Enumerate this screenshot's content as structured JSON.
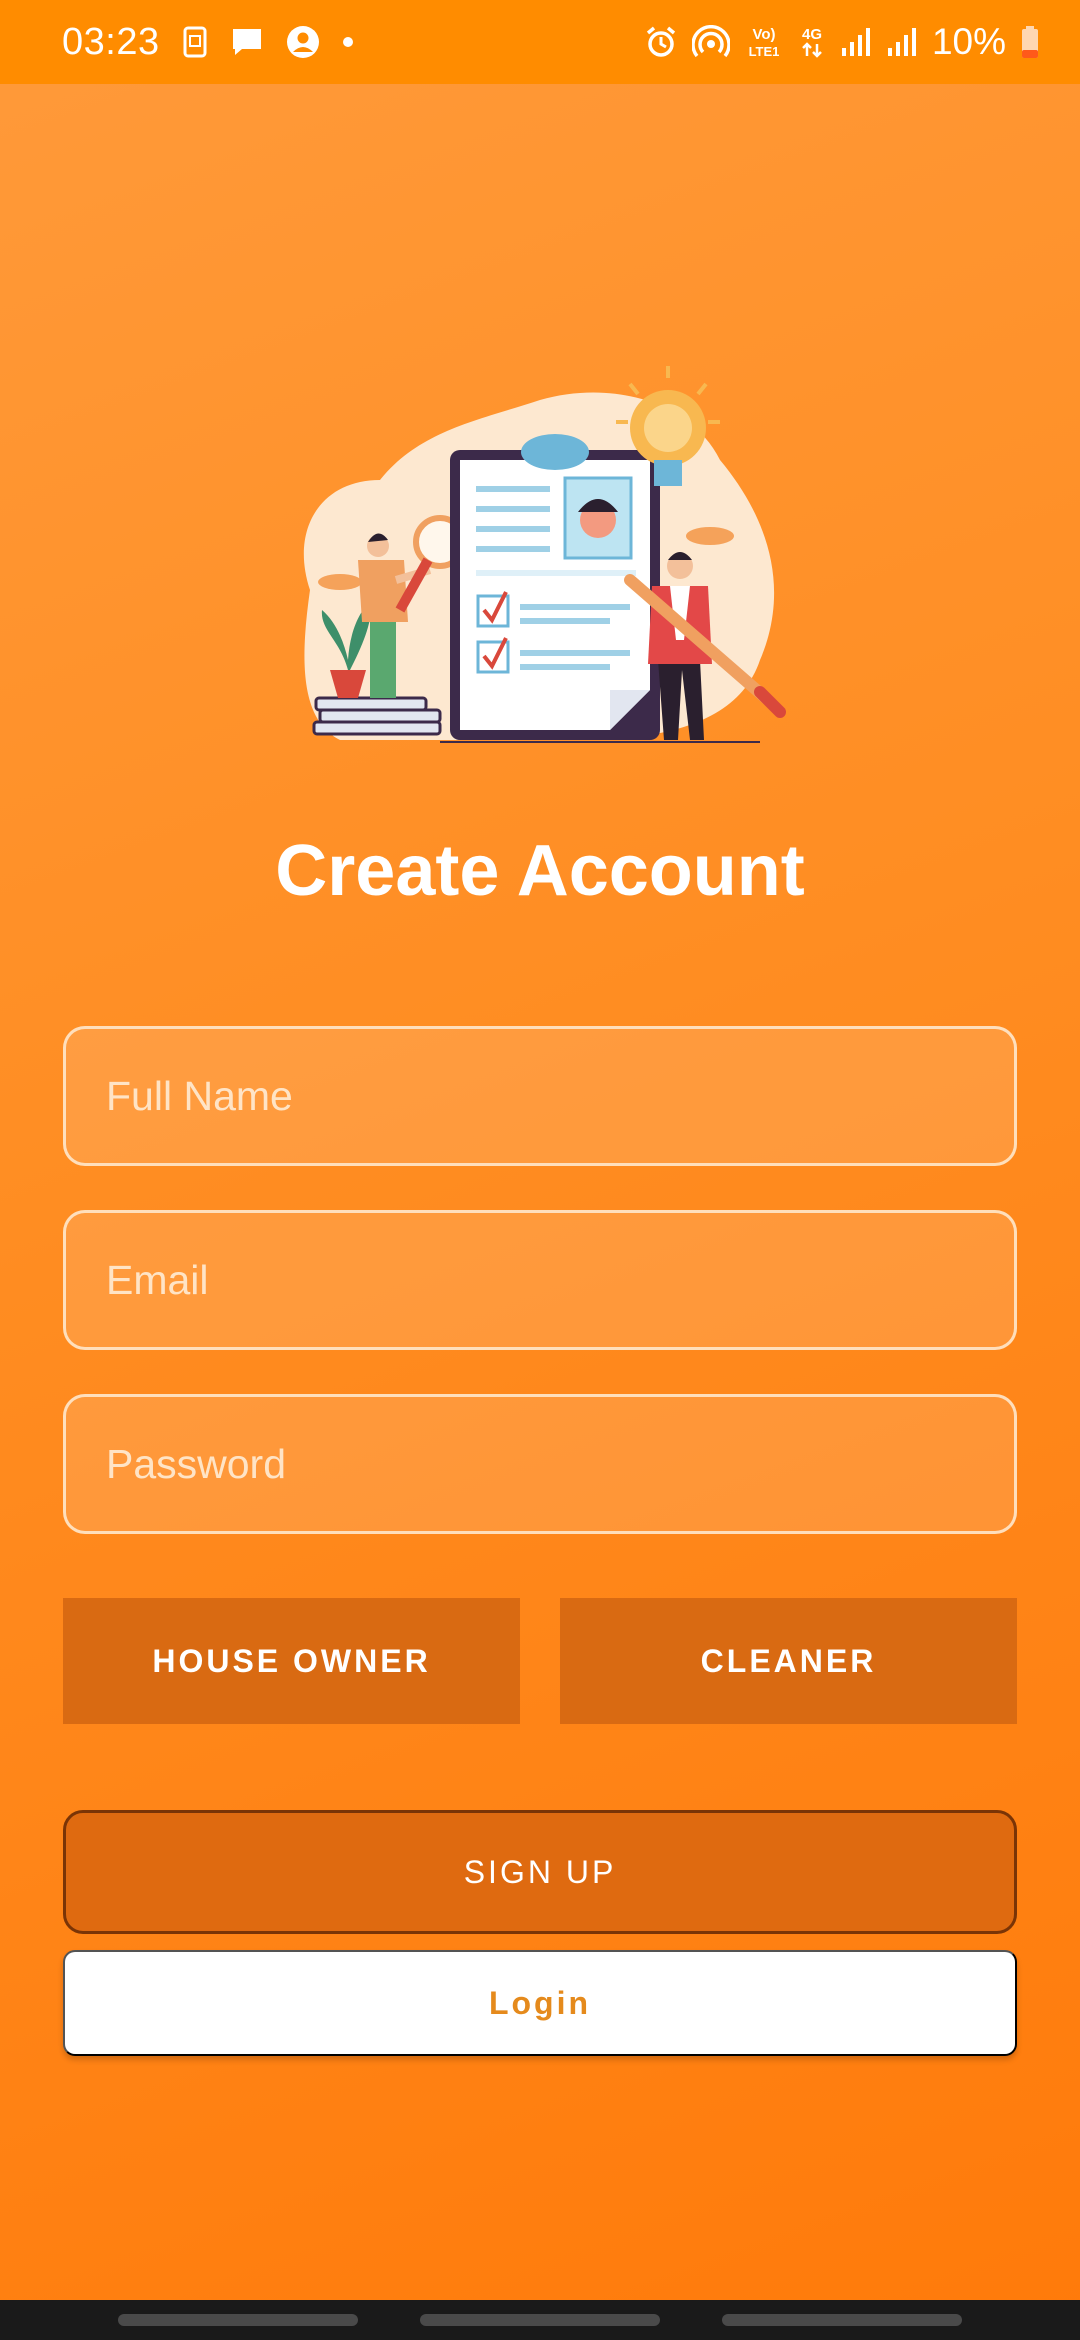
{
  "status_bar": {
    "time": "03:23",
    "battery_percent": "10%",
    "network_type": "4G",
    "volte_label": "Vo) LTE1",
    "icons_left": [
      "screenshot-icon",
      "message-icon",
      "account-icon",
      "dot-icon"
    ],
    "icons_right": [
      "alarm-icon",
      "hotspot-icon",
      "volte-icon",
      "data-4g-icon",
      "signal-icon",
      "signal-icon",
      "battery-icon"
    ]
  },
  "illustration": {
    "icon": "resume-clipboard-illustration"
  },
  "page": {
    "title": "Create Account"
  },
  "form": {
    "full_name": {
      "value": "",
      "placeholder": "Full Name"
    },
    "email": {
      "value": "",
      "placeholder": "Email"
    },
    "password": {
      "value": "",
      "placeholder": "Password"
    }
  },
  "roles": {
    "house_owner_label": "HOUSE OWNER",
    "cleaner_label": "CLEANER"
  },
  "actions": {
    "signup_label": "SIGN UP",
    "login_label": "Login"
  },
  "colors": {
    "status_bar": "#ff8c00",
    "background": "#ff8d22",
    "role_button": "#d96a12",
    "signup_button": "#df6a10",
    "login_text": "#e58a1c"
  }
}
